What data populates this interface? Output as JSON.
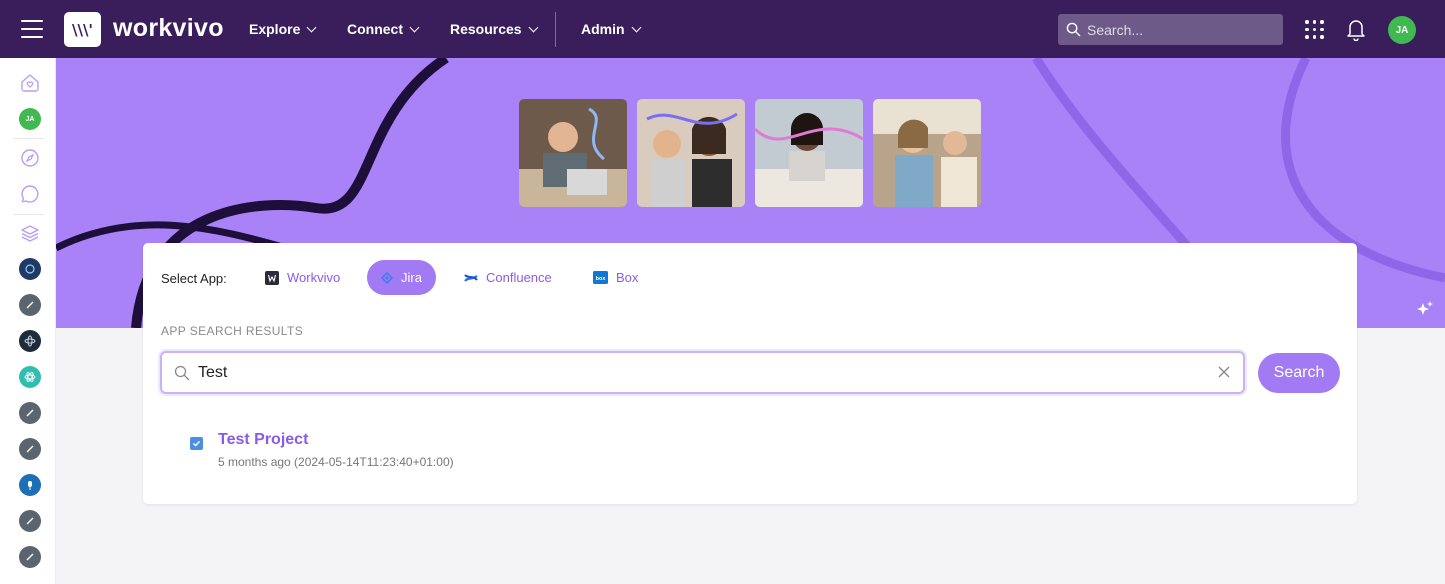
{
  "brand": {
    "logo_mark": "\\\\\\'",
    "name": "workvivo"
  },
  "nav": [
    {
      "label": "Explore"
    },
    {
      "label": "Connect"
    },
    {
      "label": "Resources"
    },
    {
      "label": "Admin"
    }
  ],
  "topbar": {
    "search_placeholder": "Search...",
    "avatar_initials": "JA"
  },
  "leftrail": {
    "avatar_initials": "JA",
    "icons": [
      "home-heart-icon",
      "avatar",
      "compass-icon",
      "chat-bubble-icon",
      "layers-icon",
      "space-avatar",
      "space-avatar",
      "space-avatar",
      "space-avatar",
      "space-avatar",
      "space-avatar",
      "space-avatar",
      "space-avatar",
      "space-avatar"
    ]
  },
  "app_selector": {
    "label": "Select App:",
    "apps": [
      {
        "name": "Workvivo",
        "icon": "workvivo-icon",
        "active": false
      },
      {
        "name": "Jira",
        "icon": "jira-icon",
        "active": true
      },
      {
        "name": "Confluence",
        "icon": "confluence-icon",
        "active": false
      },
      {
        "name": "Box",
        "icon": "box-icon",
        "active": false
      }
    ]
  },
  "results": {
    "section_label": "APP SEARCH RESULTS",
    "query": "Test",
    "search_button": "Search",
    "items": [
      {
        "title": "Test Project",
        "meta": "5 months ago (2024-05-14T11:23:40+01:00)",
        "checked": true
      }
    ]
  },
  "colors": {
    "topbar": "#3a1e5c",
    "hero": "#a982f7",
    "accent": "#8a5bea",
    "button": "#a27af3",
    "avatar_green": "#3fb950"
  }
}
